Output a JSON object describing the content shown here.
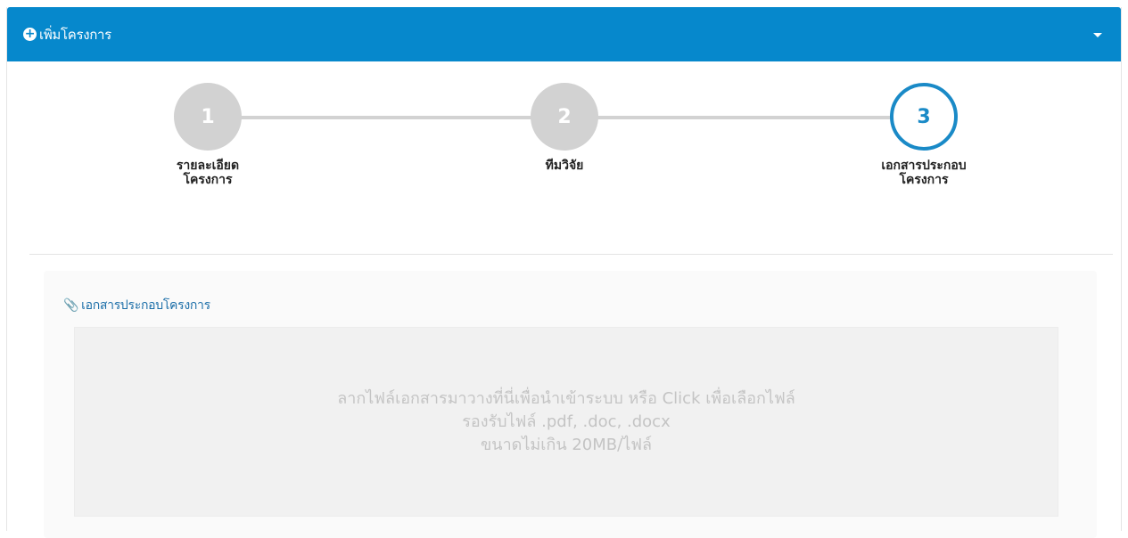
{
  "header": {
    "title": "เพิ่มโครงการ",
    "plus_icon": "plus-circle-icon",
    "toggle_icon": "caret-down-icon",
    "color": "#0688cc"
  },
  "wizard": {
    "steps": [
      {
        "number": "1",
        "label": "รายละเอียด\nโครงการ",
        "state": "inactive"
      },
      {
        "number": "2",
        "label": "ทีมวิจัย",
        "state": "inactive"
      },
      {
        "number": "3",
        "label": "เอกสารประกอบ\nโครงการ",
        "state": "active"
      }
    ],
    "active_color": "#1a8ac7",
    "inactive_color": "#d2d2d2"
  },
  "documents": {
    "heading": "เอกสารประกอบโครงการ",
    "heading_icon": "paperclip-icon",
    "dropzone": {
      "line1": "ลากไฟล์เอกสารมาวางที่นี่เพื่อนำเข้าระบบ หรือ Click เพื่อเลือกไฟล์",
      "line2": "รองรับไฟล์ .pdf, .doc, .docx",
      "line3": "ขนาดไม่เกิน 20MB/ไฟล์"
    }
  }
}
